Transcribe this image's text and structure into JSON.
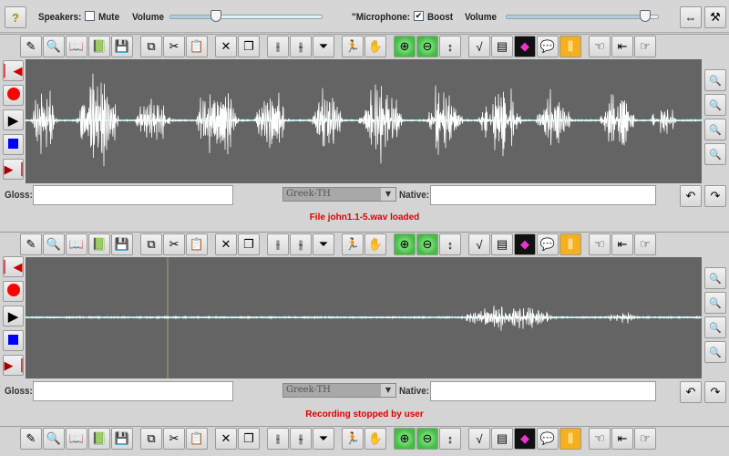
{
  "top": {
    "help": "?",
    "speakers_label": "Speakers:",
    "mute_label": "Mute",
    "mute_checked": false,
    "volume_label": "Volume",
    "speaker_volume": 0.33,
    "microphone_label": "\"Microphone:",
    "boost_label": "Boost",
    "boost_checked": true,
    "mic_volume": 0.93
  },
  "toolbar_groups": [
    [
      "pen-icon",
      "search-file-icon",
      "open-book-icon",
      "import-book-icon",
      "save-icon"
    ],
    [
      "copy-icon",
      "cut-icon",
      "paste-icon"
    ],
    [
      "delete-icon",
      "duplicate-icon"
    ],
    [
      "split-icon",
      "join-icon",
      "filter-icon"
    ],
    [
      "runner-icon",
      "hand-icon"
    ],
    [
      "zoom-in-green-icon",
      "zoom-out-green-icon",
      "vertical-scale-icon"
    ],
    [
      "pitch-icon",
      "document-icon",
      "spectrum-icon",
      "speech-bubble-icon",
      "spectrogram-icon"
    ],
    [
      "point-left-icon",
      "waveform-arrow-icon",
      "point-right-icon"
    ]
  ],
  "panels": [
    {
      "gloss_label": "Gloss:",
      "gloss_value": "",
      "language": "Greek-TH",
      "native_label": "Native:",
      "native_value": "",
      "status": "File  john1.1-5.wav loaded"
    },
    {
      "gloss_label": "Gloss:",
      "gloss_value": "",
      "language": "Greek-TH",
      "native_label": "Native:",
      "native_value": "",
      "status": "Recording stopped by user"
    }
  ],
  "colors": {
    "wave_bg": "#646464",
    "baseline": "#5fd0d0",
    "status": "#dd0000"
  }
}
